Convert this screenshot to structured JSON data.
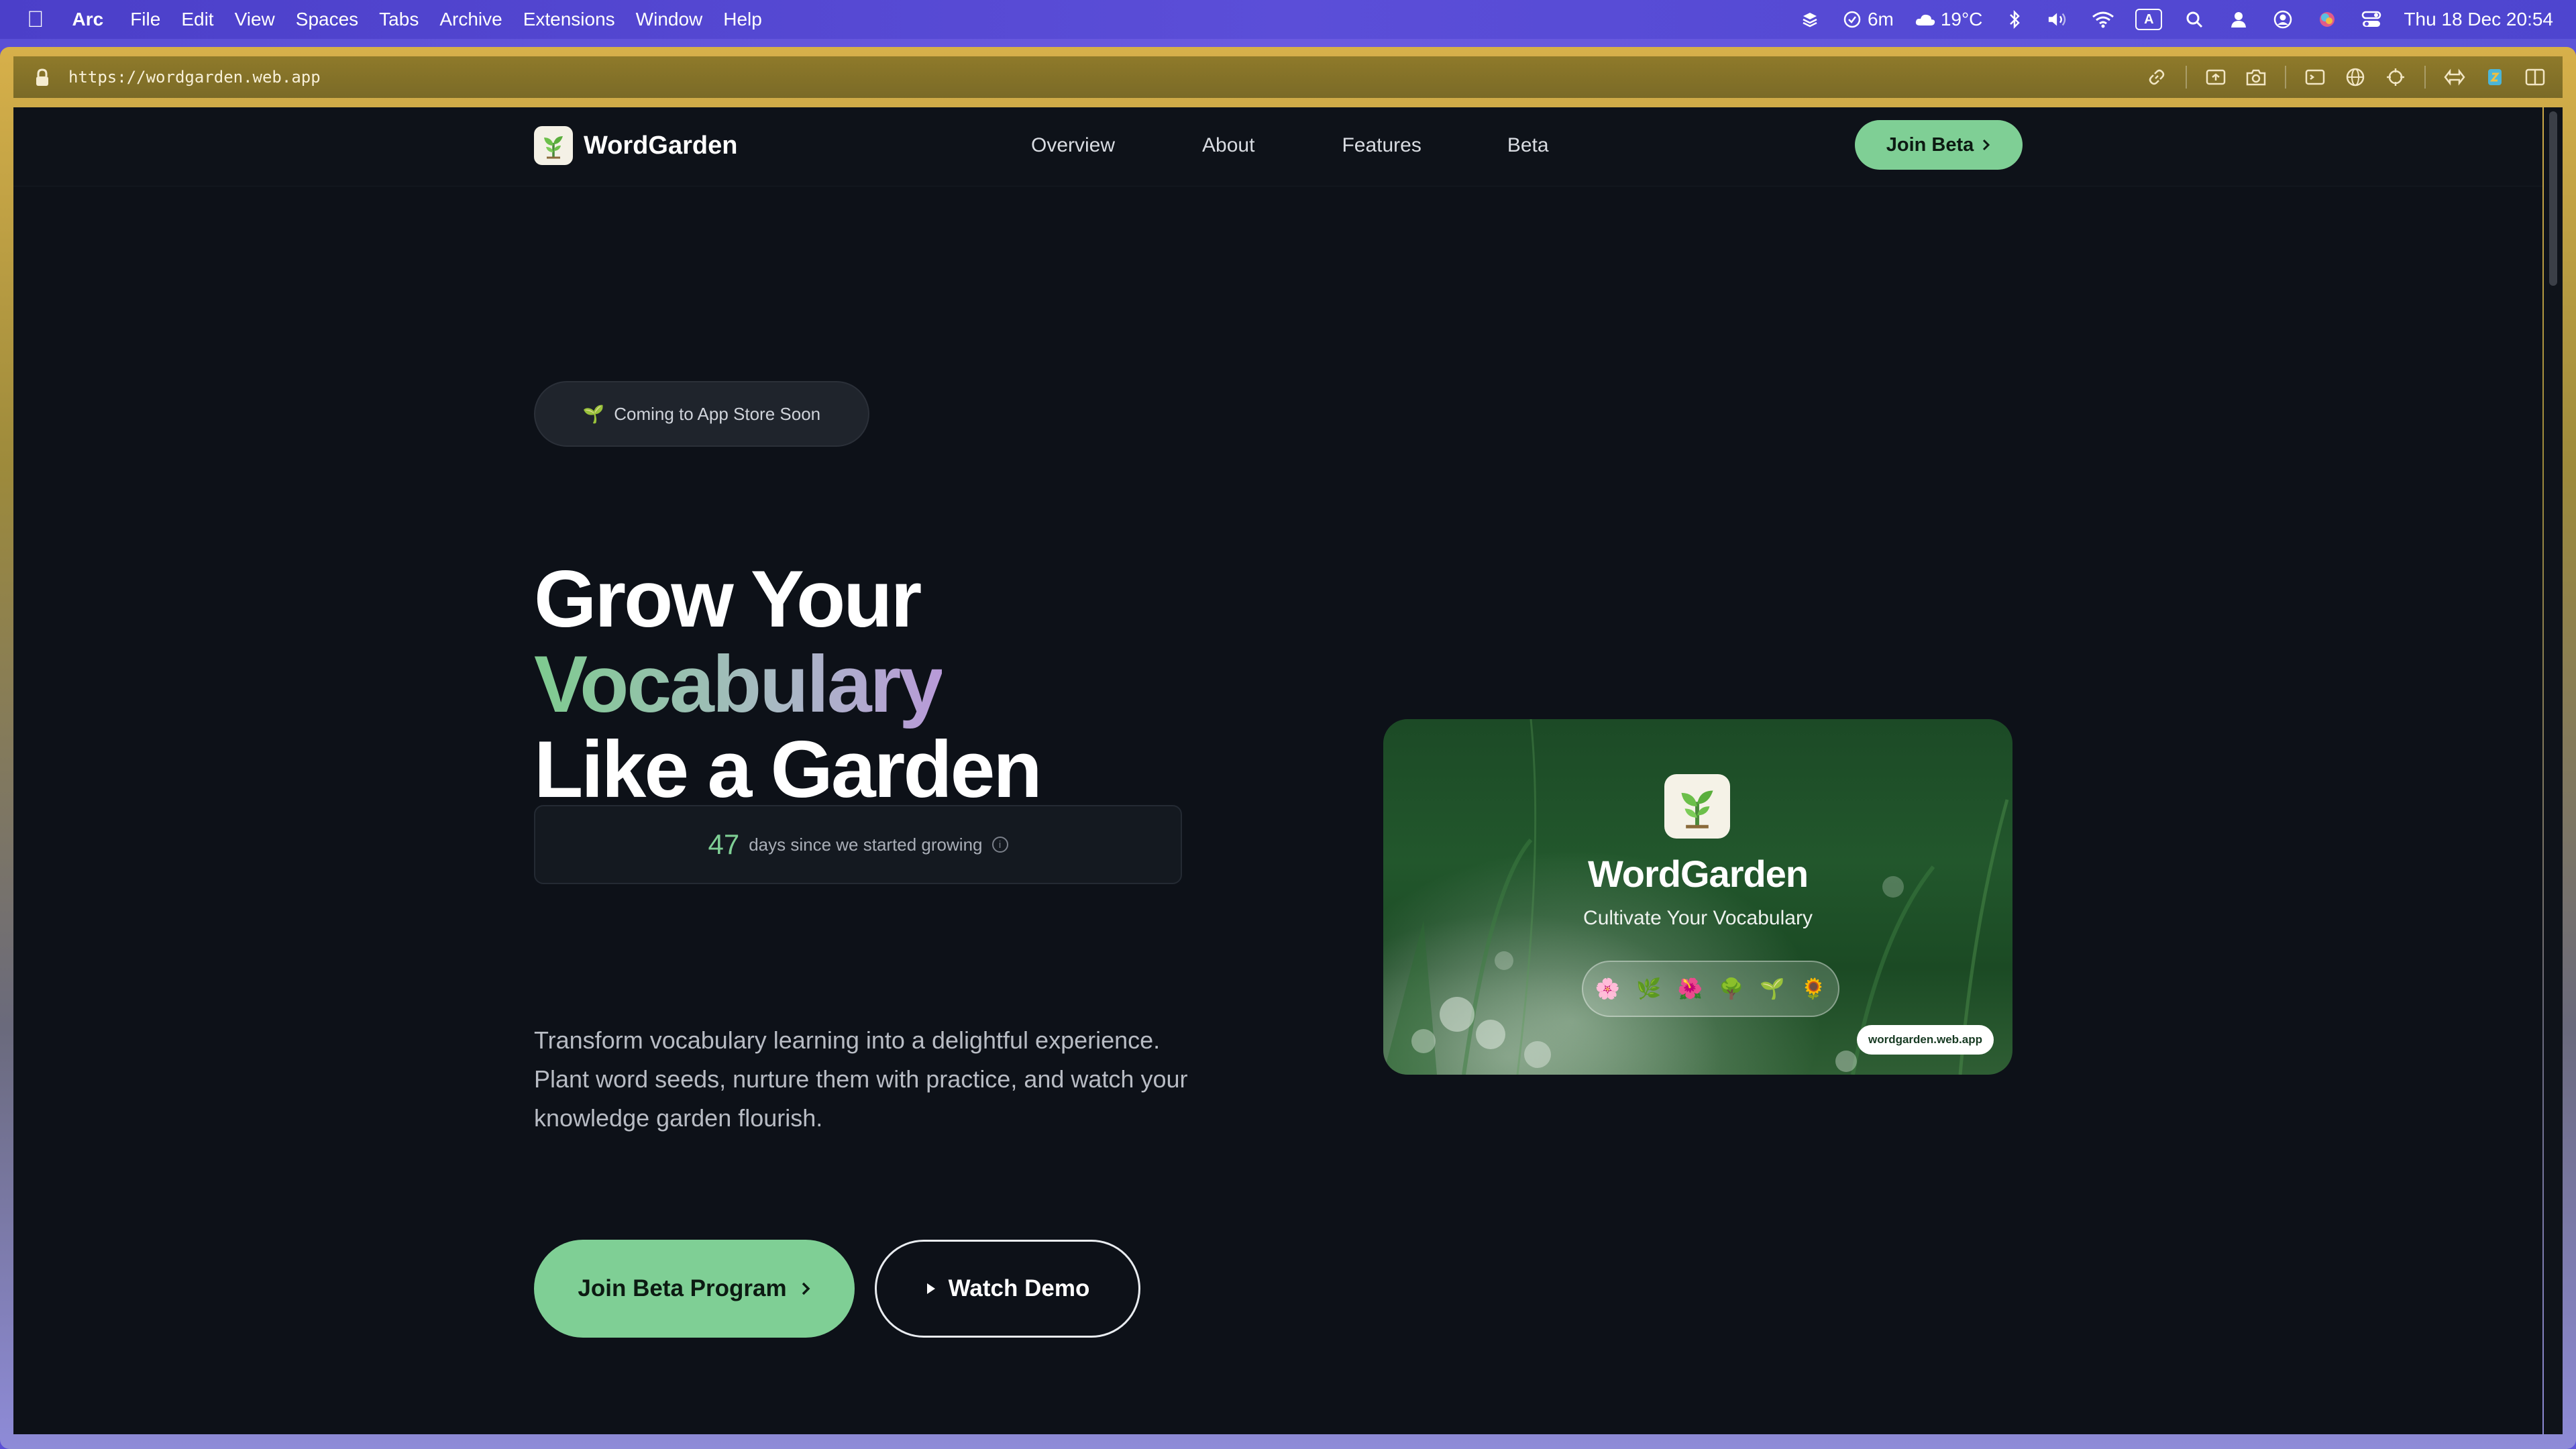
{
  "menubar": {
    "app": "Arc",
    "items": [
      "File",
      "Edit",
      "View",
      "Spaces",
      "Tabs",
      "Archive",
      "Extensions",
      "Window",
      "Help"
    ],
    "status": {
      "timer": "6m",
      "weather": "19°C",
      "datetime": "Thu 18 Dec  20:54"
    },
    "icons": [
      "stack-icon",
      "timer-icon",
      "cloud-icon",
      "bluetooth-icon",
      "volume-icon",
      "wifi-icon",
      "input-source-icon",
      "spotlight-icon",
      "user-icon",
      "account-icon",
      "color-icon",
      "control-center-icon"
    ],
    "input_source": "A"
  },
  "browser": {
    "url": "https://wordgarden.web.app",
    "toolbar_icons": [
      "link-icon",
      "capture-icon",
      "camera-icon",
      "console-icon",
      "globe-icon",
      "target-icon",
      "extensions-icon",
      "boost-icon",
      "sidebar-icon"
    ]
  },
  "nav": {
    "brand": "WordGarden",
    "links": [
      "Overview",
      "About",
      "Features",
      "Beta"
    ],
    "cta": "Join Beta"
  },
  "hero": {
    "badge": "Coming to App Store Soon",
    "badge_emoji": "🌱",
    "headline_line1": "Grow Your",
    "headline_line2": "Vocabulary",
    "headline_line3": "Like a Garden",
    "counter_value": "47",
    "counter_label": "days since we started growing",
    "description": "Transform vocabulary learning into a delightful experience. Plant word seeds, nurture them with practice, and watch your knowledge garden flourish.",
    "primary_cta": "Join Beta Program",
    "secondary_cta": "Watch Demo"
  },
  "preview_card": {
    "title": "WordGarden",
    "subtitle": "Cultivate Your Vocabulary",
    "emojis": [
      "🌸",
      "🌿",
      "🌺",
      "🌳",
      "🌱",
      "🌻"
    ],
    "url_badge": "wordgarden.web.app"
  },
  "colors": {
    "accent": "#7fcf95",
    "page_bg": "#0d1118",
    "gradient_end": "#b89ad8"
  }
}
